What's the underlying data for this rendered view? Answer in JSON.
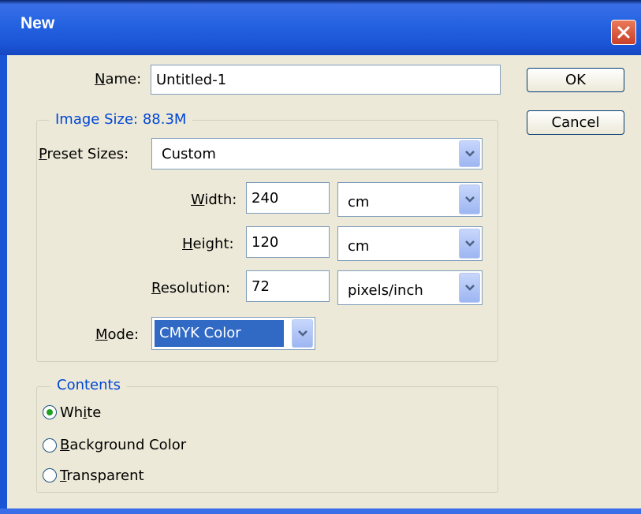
{
  "window": {
    "title": "New"
  },
  "name": {
    "label": "Name:",
    "value": "Untitled-1"
  },
  "buttons": {
    "ok": "OK",
    "cancel": "Cancel"
  },
  "image_size": {
    "legend": "Image Size: 88.3M",
    "preset": {
      "label": "Preset Sizes:",
      "value": "Custom"
    },
    "width": {
      "label": "Width:",
      "value": "240",
      "unit": "cm"
    },
    "height": {
      "label": "Height:",
      "value": "120",
      "unit": "cm"
    },
    "resolution": {
      "label": "Resolution:",
      "value": "72",
      "unit": "pixels/inch"
    },
    "mode": {
      "label": "Mode:",
      "value": "CMYK Color"
    }
  },
  "contents": {
    "legend": "Contents",
    "options": [
      {
        "label": "White",
        "selected": true
      },
      {
        "label": "Background Color",
        "selected": false
      },
      {
        "label": "Transparent",
        "selected": false
      }
    ]
  },
  "icons": {
    "close": "close-icon",
    "dropdown": "chevron-down-icon"
  },
  "colors": {
    "titlebar": "#2462e0",
    "accent_text": "#0046d5",
    "selection": "#316ac5",
    "dialog_bg": "#ece9d8"
  }
}
